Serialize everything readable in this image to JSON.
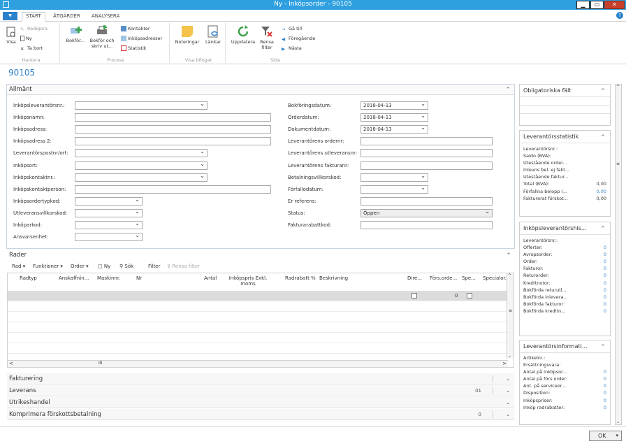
{
  "window": {
    "title": "Ny - Inköpsorder - 90105",
    "min": "▁",
    "max": "▭",
    "close": "✕"
  },
  "ribbon": {
    "tabs": [
      "START",
      "ÅTGÄRDER",
      "ANALYSERA"
    ],
    "buttons": {
      "visa": "Visa",
      "redigera": "Redigera",
      "ny": "Ny",
      "ta_bort": "Ta bort",
      "bokfor": "Bokför...",
      "bokfor_skriv": "Bokför och skriv ut...",
      "kontakter": "Kontakter",
      "inkopsadresser": "Inköpsadresser",
      "statistik": "Statistik",
      "noteringar": "Noteringar",
      "lankar": "Länkar",
      "uppdatera": "Uppdatera",
      "rensa_filter": "Rensa filter",
      "ga_till": "Gå till",
      "foregaende": "Föregående",
      "nasta": "Nästa"
    },
    "groups": {
      "hantera": "Hantera",
      "process": "Process",
      "visa_bifogat": "Visa bifogat",
      "sida": "Sida"
    }
  },
  "page": {
    "number": "90105"
  },
  "allmant": {
    "title": "Allmänt",
    "left_fields": [
      {
        "label": "Inköpsleverantörsnr.:",
        "value": ""
      },
      {
        "label": "Inköpsnamn:",
        "value": ""
      },
      {
        "label": "Inköpsadress:",
        "value": ""
      },
      {
        "label": "Inköpsadress 2:",
        "value": ""
      },
      {
        "label": "Leverantörspostnr/ort:",
        "value": ""
      },
      {
        "label": "Inköpsort:",
        "value": ""
      },
      {
        "label": "Inköpskontaktnr.:",
        "value": ""
      },
      {
        "label": "Inköpskontaktperson:",
        "value": ""
      },
      {
        "label": "Inköpsordertypkod:",
        "value": ""
      },
      {
        "label": "Utleveransvillkorskod:",
        "value": ""
      },
      {
        "label": "Inköparkod:",
        "value": ""
      },
      {
        "label": "Ansvarsenhet:",
        "value": ""
      }
    ],
    "right_fields": [
      {
        "label": "Bokföringsdatum:",
        "value": "2018-04-13"
      },
      {
        "label": "Orderdatum:",
        "value": "2018-04-13"
      },
      {
        "label": "Dokumentdatum:",
        "value": "2018-04-13"
      },
      {
        "label": "Leverantörens ordernr:",
        "value": ""
      },
      {
        "label": "Leverantörens utleveransnr:",
        "value": ""
      },
      {
        "label": "Leverantörens fakturanr:",
        "value": ""
      },
      {
        "label": "Betalningsvillkorskod:",
        "value": ""
      },
      {
        "label": "Förfallodatum:",
        "value": ""
      },
      {
        "label": "Er referens:",
        "value": ""
      },
      {
        "label": "Status:",
        "value": "Öppen"
      },
      {
        "label": "Fakturarabattkod:",
        "value": ""
      }
    ]
  },
  "rader": {
    "title": "Rader",
    "toolbar": [
      "Rad",
      "Funktioner",
      "Order",
      "Ny",
      "Sök",
      "Filter",
      "Rensa filter"
    ],
    "columns": [
      "Radtyp",
      "Anskaffnin...",
      "Maskinnr.",
      "Nr",
      "Antal",
      "Inköpspris Exkl. moms",
      "Radrabatt %",
      "Beskrivning",
      "Dire...",
      "Förs.orde...",
      "Spe...",
      "Specialor..."
    ],
    "row": {
      "fors_order": "0"
    },
    "hscroll_grip": "III"
  },
  "collapsed": [
    {
      "title": "Fakturering",
      "count": ""
    },
    {
      "title": "Leverans",
      "count": "01"
    },
    {
      "title": "Utrikeshandel",
      "count": ""
    },
    {
      "title": "Komprimera förskottsbetalning",
      "count": "0"
    }
  ],
  "factboxes": {
    "obligatoriska": {
      "title": "Obligatoriska fält"
    },
    "statistik": {
      "title": "Leverantörsstatistik",
      "rows": [
        {
          "label": "Leverantörsnr.:",
          "value": ""
        },
        {
          "label": "Saldo (BVA):",
          "value": ""
        },
        {
          "label": "Utestående order...",
          "value": ""
        },
        {
          "label": "Inlevns bel. ej fakt...",
          "value": ""
        },
        {
          "label": "Utestående faktur...",
          "value": ""
        },
        {
          "label": "Total (BVA):",
          "value": "0,00"
        },
        {
          "label": "Förfallna belopp (...",
          "value": "0,00"
        },
        {
          "label": "Fakturerat förskot...",
          "value": "0,00"
        }
      ]
    },
    "historik": {
      "title": "Inköpsleverantörshis...",
      "rows": [
        {
          "label": "Leverantörsnr.:",
          "value": ""
        },
        {
          "label": "Offerter:",
          "value": "0"
        },
        {
          "label": "Avropsorder:",
          "value": "0"
        },
        {
          "label": "Order:",
          "value": "0"
        },
        {
          "label": "Fakturor:",
          "value": "0"
        },
        {
          "label": "Returorder:",
          "value": "0"
        },
        {
          "label": "Kreditnotor:",
          "value": "0"
        },
        {
          "label": "Bokförda returutl...",
          "value": "0"
        },
        {
          "label": "Bokförda inlevera...",
          "value": "0"
        },
        {
          "label": "Bokförda fakturor:",
          "value": "0"
        },
        {
          "label": "Bokförda kreditn...",
          "value": "0"
        }
      ]
    },
    "information": {
      "title": "Leverantörsinformati...",
      "rows": [
        {
          "label": "Artikelnr.:",
          "value": ""
        },
        {
          "label": "Ersättningsvara:",
          "value": ""
        },
        {
          "label": "Antal på inköpsor...",
          "value": "0"
        },
        {
          "label": "Antal på förs.order:",
          "value": "0"
        },
        {
          "label": "Ant. på serviceor...",
          "value": "0"
        },
        {
          "label": "Disposition:",
          "value": "0"
        },
        {
          "label": "Inköpspriser:",
          "value": "0"
        },
        {
          "label": "Inköp radrabatter:",
          "value": "0"
        }
      ]
    }
  },
  "footer": {
    "ok": "OK"
  },
  "colors": {
    "accent": "#2ea0df",
    "link": "#2d7fc6",
    "close": "#c7402b"
  }
}
